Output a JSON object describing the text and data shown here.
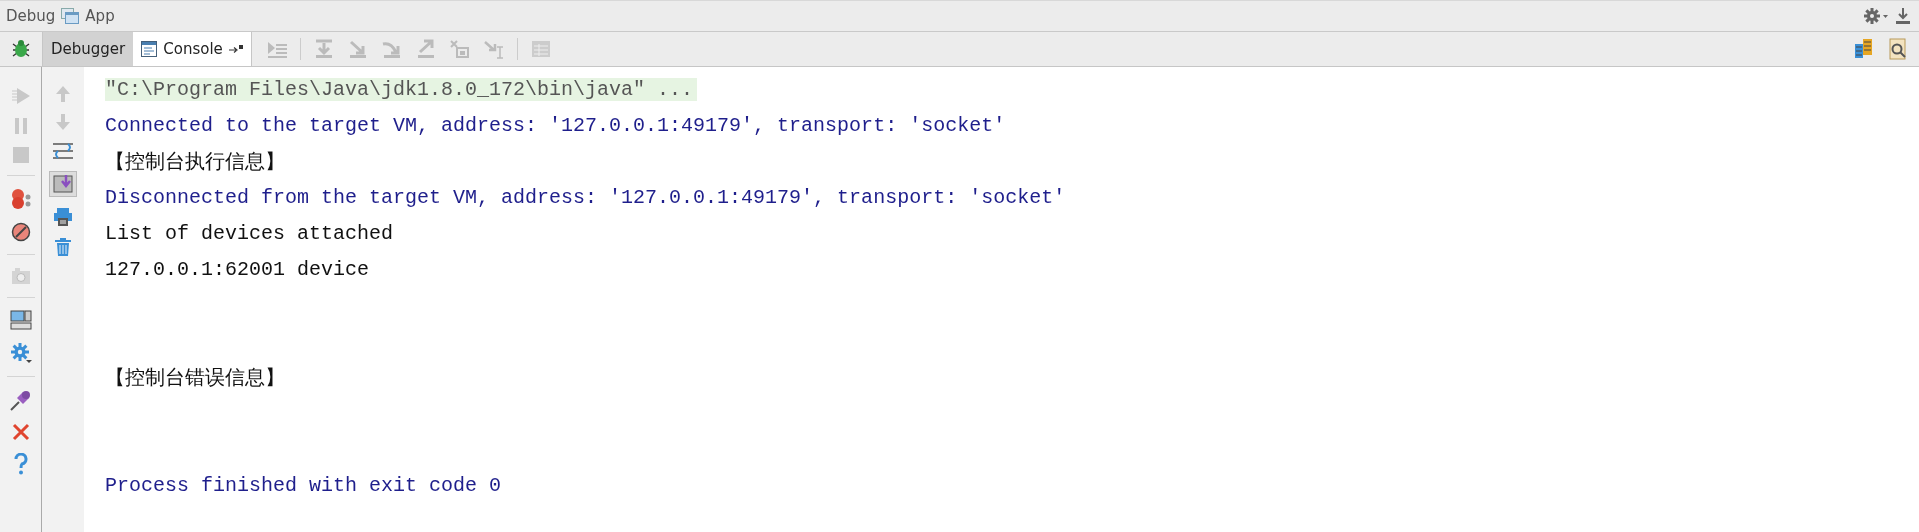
{
  "title_bar": {
    "title": "Debug",
    "config": "App"
  },
  "tabs": [
    {
      "label": "Debugger",
      "selected": false
    },
    {
      "label": "Console",
      "selected": true
    }
  ],
  "console": [
    {
      "kind": "command",
      "text": "\"C:\\Program Files\\Java\\jdk1.8.0_172\\bin\\java\" ..."
    },
    {
      "kind": "system",
      "text": "Connected to the target VM, address: '127.0.0.1:49179', transport: 'socket'"
    },
    {
      "kind": "output",
      "text": "【控制台执行信息】"
    },
    {
      "kind": "system",
      "text": "Disconnected from the target VM, address: '127.0.0.1:49179', transport: 'socket'"
    },
    {
      "kind": "output",
      "text": "List of devices attached"
    },
    {
      "kind": "output",
      "text": "127.0.0.1:62001 device"
    },
    {
      "kind": "blank"
    },
    {
      "kind": "blank"
    },
    {
      "kind": "output",
      "text": "【控制台错误信息】"
    },
    {
      "kind": "blank"
    },
    {
      "kind": "blank"
    },
    {
      "kind": "system",
      "text": "Process finished with exit code 0"
    }
  ]
}
